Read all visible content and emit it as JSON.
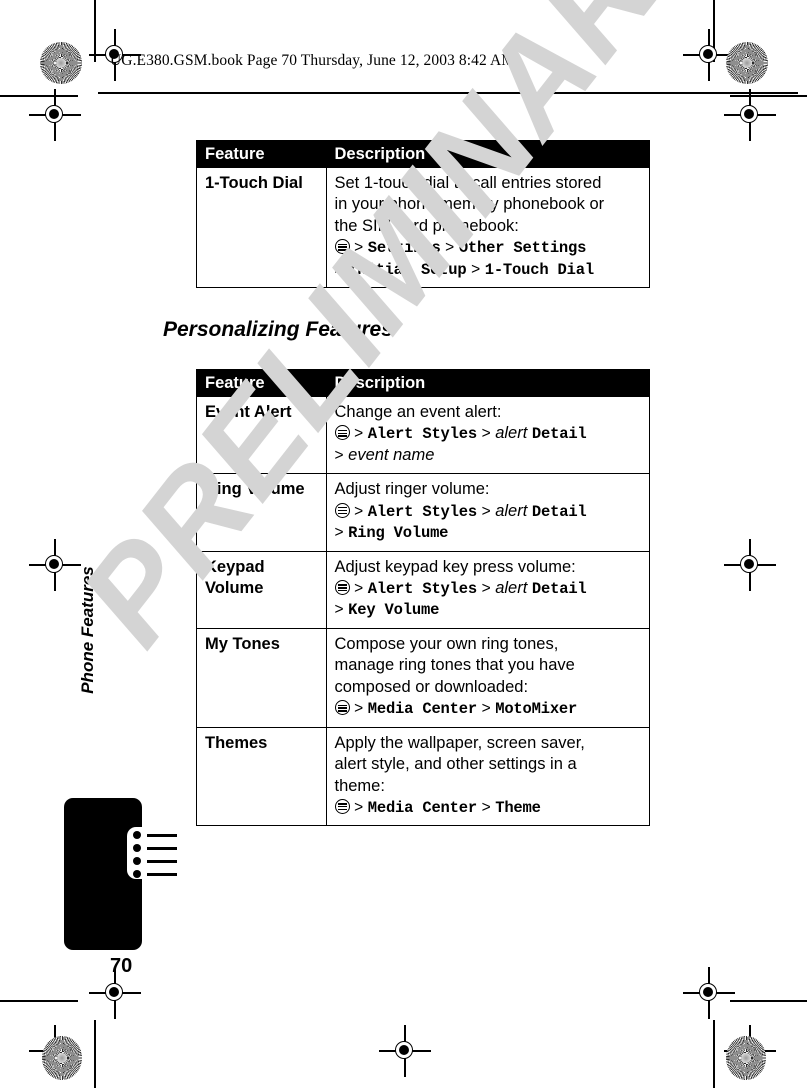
{
  "document": {
    "running_head": "UG.E380.GSM.book  Page 70  Thursday, June 12, 2003  8:42 AM",
    "page_number": "70",
    "watermark": "PRELIMINARY",
    "side_tab_label": "Phone Features",
    "section_heading": "Personalizing Features"
  },
  "icons": {
    "menu_key": "menu-key-icon",
    "tab_list": "list-icon"
  },
  "table1": {
    "columns": [
      "Feature",
      "Description"
    ],
    "rows": [
      {
        "feature": "1-Touch Dial",
        "desc_lines": [
          "Set 1-touch dial to call entries stored",
          "in your phone memory phonebook or",
          "the SIM card phonebook:"
        ],
        "path": [
          {
            "type": "icon",
            "text": "menu-key-icon"
          },
          {
            "type": "sep",
            "text": ">"
          },
          {
            "type": "mono",
            "text": "Settings"
          },
          {
            "type": "sep",
            "text": ">"
          },
          {
            "type": "mono",
            "text": "Other Settings"
          },
          {
            "type": "break",
            "text": ""
          },
          {
            "type": "sep",
            "text": ">"
          },
          {
            "type": "mono",
            "text": "Initial Setup"
          },
          {
            "type": "sep",
            "text": ">"
          },
          {
            "type": "mono",
            "text": "1-Touch Dial"
          }
        ]
      }
    ]
  },
  "table2": {
    "columns": [
      "Feature",
      "Description"
    ],
    "rows": [
      {
        "feature": "Event Alert",
        "desc_lines": [
          "Change an event alert:"
        ],
        "path": [
          {
            "type": "icon",
            "text": "menu-key-icon"
          },
          {
            "type": "sep",
            "text": ">"
          },
          {
            "type": "mono",
            "text": "Alert Styles"
          },
          {
            "type": "sep",
            "text": ">"
          },
          {
            "type": "ital",
            "text": "alert"
          },
          {
            "type": "mono",
            "text": "Detail"
          },
          {
            "type": "break",
            "text": ""
          },
          {
            "type": "sep",
            "text": ">"
          },
          {
            "type": "ital",
            "text": "event name"
          }
        ]
      },
      {
        "feature": "Ring Volume",
        "desc_lines": [
          "Adjust ringer volume:"
        ],
        "path": [
          {
            "type": "icon",
            "text": "menu-key-icon"
          },
          {
            "type": "sep",
            "text": ">"
          },
          {
            "type": "mono",
            "text": "Alert Styles"
          },
          {
            "type": "sep",
            "text": ">"
          },
          {
            "type": "ital",
            "text": "alert"
          },
          {
            "type": "mono",
            "text": "Detail"
          },
          {
            "type": "break",
            "text": ""
          },
          {
            "type": "sep",
            "text": ">"
          },
          {
            "type": "mono",
            "text": "Ring Volume"
          }
        ]
      },
      {
        "feature": "Keypad Volume",
        "desc_lines": [
          "Adjust keypad key press volume:"
        ],
        "path": [
          {
            "type": "icon",
            "text": "menu-key-icon"
          },
          {
            "type": "sep",
            "text": ">"
          },
          {
            "type": "mono",
            "text": "Alert Styles"
          },
          {
            "type": "sep",
            "text": ">"
          },
          {
            "type": "ital",
            "text": "alert"
          },
          {
            "type": "mono",
            "text": "Detail"
          },
          {
            "type": "break",
            "text": ""
          },
          {
            "type": "sep",
            "text": ">"
          },
          {
            "type": "mono",
            "text": "Key Volume"
          }
        ]
      },
      {
        "feature": "My Tones",
        "desc_lines": [
          "Compose your own ring tones,",
          "manage ring tones that you have",
          "composed or downloaded:"
        ],
        "path": [
          {
            "type": "icon",
            "text": "menu-key-icon"
          },
          {
            "type": "sep",
            "text": ">"
          },
          {
            "type": "mono",
            "text": "Media Center"
          },
          {
            "type": "sep",
            "text": ">"
          },
          {
            "type": "mono",
            "text": "MotoMixer"
          }
        ]
      },
      {
        "feature": "Themes",
        "desc_lines": [
          "Apply the wallpaper, screen saver,",
          "alert style, and other settings in a",
          "theme:"
        ],
        "path": [
          {
            "type": "icon",
            "text": "menu-key-icon"
          },
          {
            "type": "sep",
            "text": ">"
          },
          {
            "type": "mono",
            "text": "Media Center"
          },
          {
            "type": "sep",
            "text": ">"
          },
          {
            "type": "mono",
            "text": "Theme"
          }
        ]
      }
    ]
  }
}
